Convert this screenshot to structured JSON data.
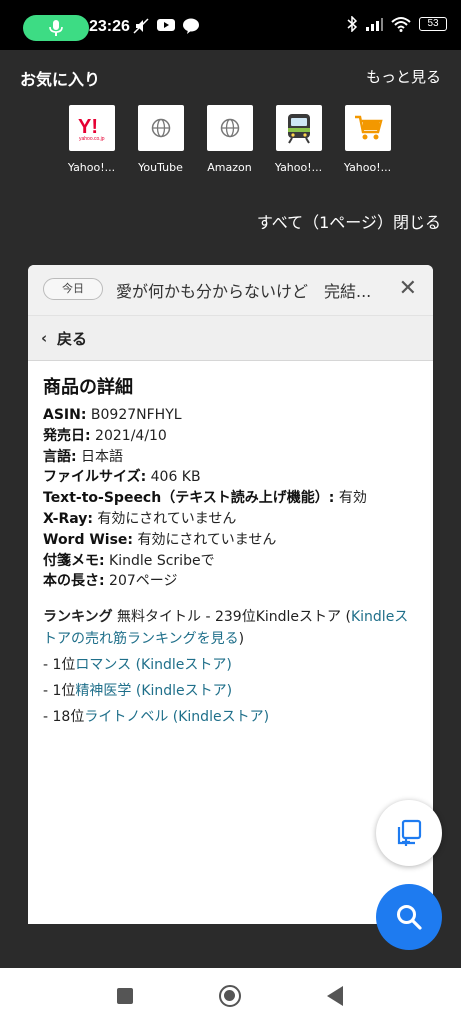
{
  "status_bar": {
    "time": "23:26",
    "battery": "53",
    "icons_left": [
      "mic-icon",
      "mute-icon",
      "youtube-icon",
      "line-icon"
    ],
    "icons_right": [
      "bluetooth-icon",
      "signal-icon",
      "wifi-icon",
      "battery-icon"
    ]
  },
  "favorites": {
    "title": "お気に入り",
    "more": "もっと見る",
    "items": [
      {
        "label": "Yahoo!...",
        "icon": "yahoo-icon"
      },
      {
        "label": "YouTube",
        "icon": "globe-icon"
      },
      {
        "label": "Amazon",
        "icon": "globe-icon"
      },
      {
        "label": "Yahoo!...",
        "icon": "train-icon"
      },
      {
        "label": "Yahoo!...",
        "icon": "cart-icon"
      }
    ],
    "close_row": "すべて（1ページ）閉じる"
  },
  "card": {
    "chip": "今日",
    "tab_title": "愛が何かも分からないけど　完結...",
    "back_label": "戻る",
    "heading": "商品の詳細",
    "details": [
      {
        "key": "ASIN:",
        "value": " B0927NFHYL"
      },
      {
        "key": "発売日:",
        "value": " 2021/4/10"
      },
      {
        "key": "言語:",
        "value": " 日本語"
      },
      {
        "key": "ファイルサイズ:",
        "value": " 406 KB"
      },
      {
        "key": "Text-to-Speech（テキスト読み上げ機能）:",
        "value": " 有効"
      },
      {
        "key": "X-Ray:",
        "value": " 有効にされていません"
      },
      {
        "key": "Word Wise:",
        "value": " 有効にされていません"
      },
      {
        "key": "付箋メモ:",
        "value": " Kindle Scribeで"
      },
      {
        "key": "本の長さ:",
        "value": " 207ページ"
      }
    ],
    "ranking": {
      "label": "ランキング",
      "text": " 無料タイトル - 239位Kindleストア (",
      "link": "Kindleストアの売れ筋ランキングを見る",
      "close": ")"
    },
    "rank_lines": [
      {
        "prefix": "- 1位",
        "link": "ロマンス (Kindleストア)"
      },
      {
        "prefix": "- 1位",
        "link": "精神医学 (Kindleストア)"
      },
      {
        "prefix": "- 18位",
        "link": "ライトノベル (Kindleストア)"
      }
    ]
  },
  "colors": {
    "background": "#2b2b2b",
    "link": "#1f6f8a",
    "fab_search": "#1e7bf0",
    "mic_pill": "#3ddc84"
  }
}
